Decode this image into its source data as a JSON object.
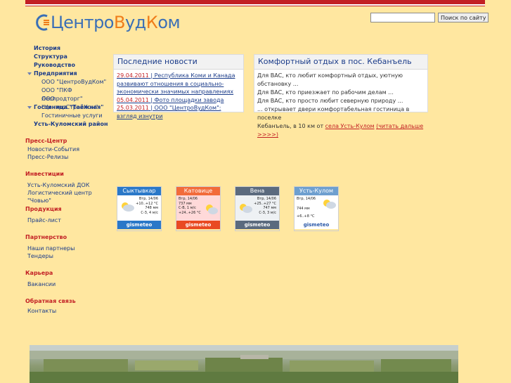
{
  "logo": {
    "text_a": "Центро",
    "text_b": "В",
    "text_c": "уд",
    "text_d": "К",
    "text_e": "ом"
  },
  "search": {
    "placeholder": "",
    "value": "",
    "button": "Поиск по сайту"
  },
  "nav": {
    "items": [
      {
        "label": "История"
      },
      {
        "label": "Структура"
      },
      {
        "label": "Руководство"
      },
      {
        "label": "Предприятия"
      },
      {
        "label": "ООО \"ЦентроВудКом\""
      },
      {
        "label": "ООО \"ПКФ Леспродторг\""
      },
      {
        "label": "ООО \"ЦентроСтройКом\""
      },
      {
        "label": "Гостиница \"Таёжная\""
      },
      {
        "label": "Гостиничные услуги"
      },
      {
        "label": "Усть-Куломский район"
      }
    ],
    "sections": [
      {
        "title": "Пресс-Центр",
        "links": [
          "Новости-События",
          "Пресс-Релизы"
        ]
      },
      {
        "title": "Инвестиции",
        "links": [
          "Усть-Куломский ДОК",
          "Логистический центр \"Човью\""
        ]
      },
      {
        "title": "Продукция",
        "links": [
          "Прайс-лист"
        ]
      },
      {
        "title": "Партнерство",
        "links": [
          "Наши партнеры",
          "Тендеры"
        ]
      },
      {
        "title": "Карьера",
        "links": [
          "Вакансии"
        ]
      },
      {
        "title": "Обратная связь",
        "links": [
          "Контакты"
        ]
      }
    ]
  },
  "news": {
    "title": "Последние новости",
    "items": [
      {
        "date": "29.04.2011",
        "text": " | Республика Коми и Канада развивают отношения в социально-экономически значимых направлениях"
      },
      {
        "date": "05.04.2011",
        "text": " | Фото площадки завода"
      },
      {
        "date": "25.03.2011",
        "text": " | ООО \"ЦентроВудКом\": взгляд изнутри"
      }
    ]
  },
  "rest": {
    "title": "Комфортный отдых в пос. Кебанъель",
    "lines": [
      "Для ВАС, кто любит комфортный отдых, уютную обстановку ...",
      "Для ВАС, кто приезжает по рабочим делам ...",
      "Для ВАС, кто просто любит северную природу ...",
      "... открывает двери комфортабельная гостиница в поселке",
      "Кебанъель, в 10 км от "
    ],
    "link_place": "села Усть-Кулом",
    "link_more": "(читать дальше >>>>)"
  },
  "weather": [
    {
      "city": "Сыктывкар",
      "day": "Втр, 14/06",
      "t": "+10..+12 °C",
      "p": "748 мм",
      "w": "С-З, 4 м/с",
      "brand": "gismeteo",
      "head": "#2a78c8",
      "foot": "#2a78c8"
    },
    {
      "city": "Катовице",
      "day": "Втр, 14/06",
      "t": "737 мм",
      "p": "С-В, 1 м/с",
      "w": "+24..+26 °C",
      "brand": "gismeteo",
      "head": "#f26b3a",
      "foot": "#e94a22"
    },
    {
      "city": "Вена",
      "day": "Втр, 14/06",
      "t": "+25..+27 °C",
      "p": "747 мм",
      "w": "С-З, 3 м/с",
      "brand": "gismeteo",
      "head": "#5b6a7e",
      "foot": "#5b6a7e"
    },
    {
      "city": "Усть-Кулом",
      "day": "Втр, 14/06",
      "t": "744 мм",
      "p": "+6..+8 °C",
      "w": "",
      "brand": "gismeteo",
      "head": "#6e9fcf",
      "foot": "#ffffff"
    }
  ]
}
